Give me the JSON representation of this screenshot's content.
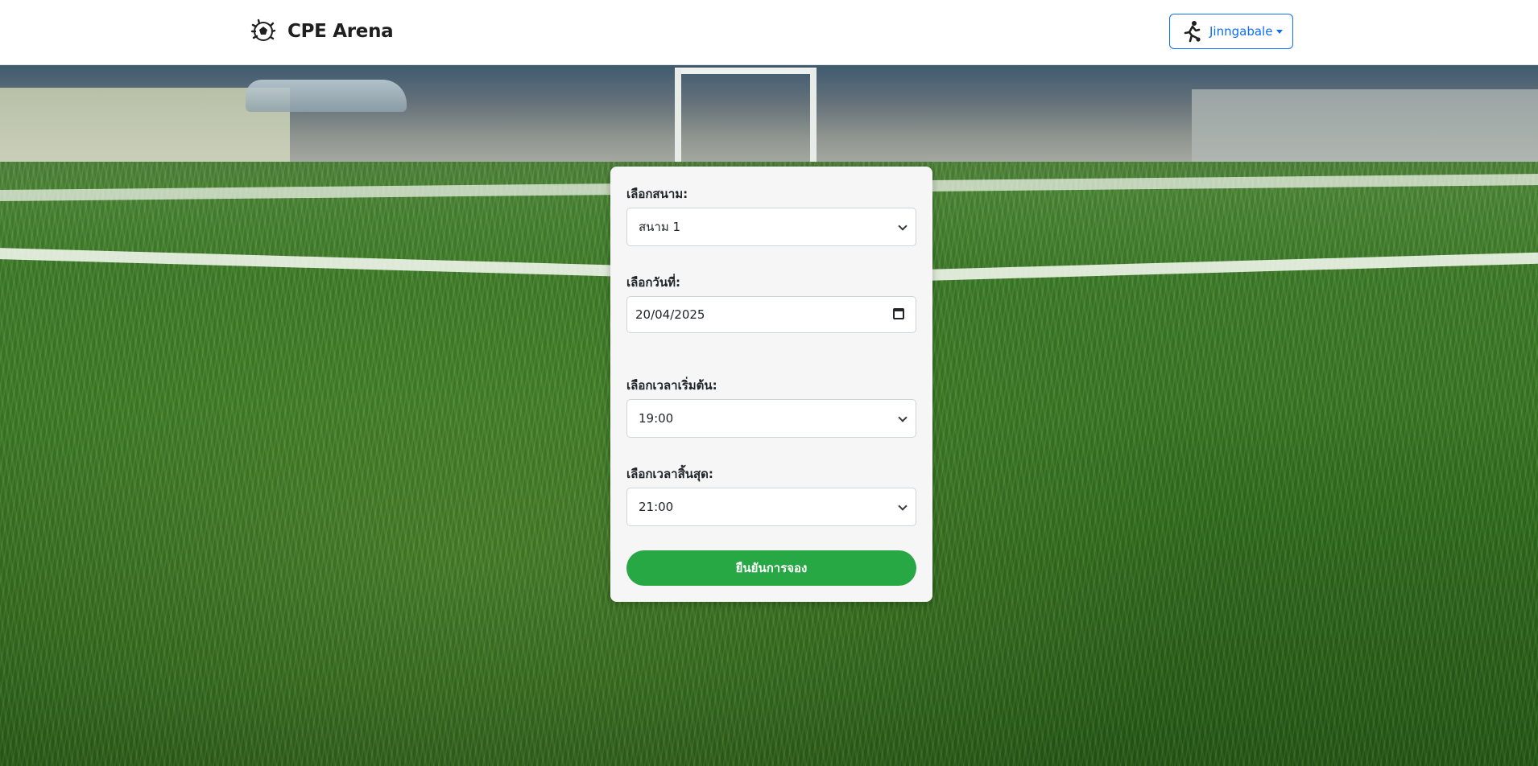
{
  "header": {
    "brand": "CPE Arena",
    "user_name": "Jinngabale"
  },
  "form": {
    "field_label": "เลือกสนาม:",
    "field_value": "สนาม 1",
    "date_label": "เลือกวันที่:",
    "date_value": "20/04/2025",
    "start_label": "เลือกเวลาเริ่มต้น:",
    "start_value": "19:00",
    "end_label": "เลือกเวลาสิ้นสุด:",
    "end_value": "21:00",
    "submit_label": "ยืนยันการจอง"
  },
  "colors": {
    "primary": "#0d6efd",
    "success": "#28a745"
  },
  "icons": {
    "brand": "soccer-ball-icon",
    "user": "soccer-player-icon"
  }
}
